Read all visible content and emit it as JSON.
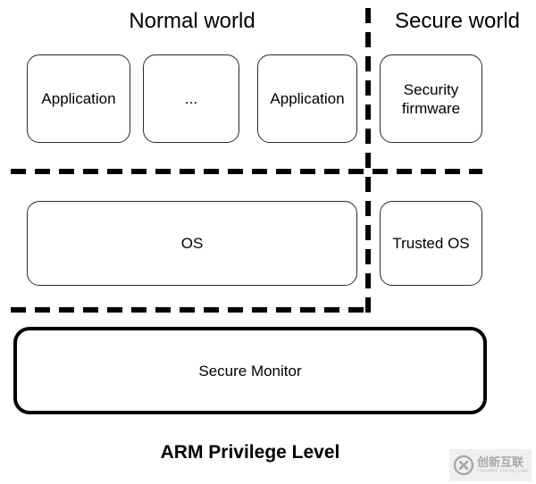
{
  "diagram": {
    "caption": "ARM Privilege Level",
    "headers": {
      "normal": "Normal world",
      "secure": "Secure world"
    },
    "rows": {
      "application_row": {
        "normal_boxes": [
          {
            "label": "Application"
          },
          {
            "label": "..."
          },
          {
            "label": "Application"
          }
        ],
        "secure_boxes": [
          {
            "label": "Security firmware"
          }
        ]
      },
      "os_row": {
        "normal_boxes": [
          {
            "label": "OS"
          }
        ],
        "secure_boxes": [
          {
            "label": "Trusted OS"
          }
        ]
      },
      "monitor_row": {
        "boxes": [
          {
            "label": "Secure Monitor"
          }
        ]
      }
    },
    "colors": {
      "background": "#ffffff",
      "box_stroke": "#2b2b2b",
      "monitor_stroke": "#000000",
      "separator": "#000000",
      "text": "#000000"
    }
  },
  "watermark": {
    "cn_text": "创新互联",
    "pinyin_text": "CHUANG XIN HU LIAN"
  }
}
